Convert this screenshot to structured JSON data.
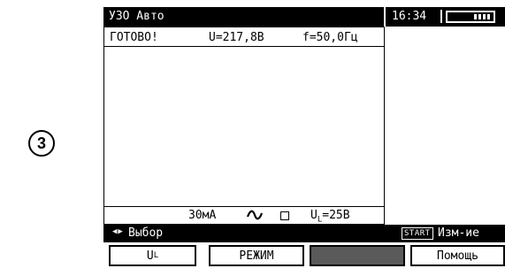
{
  "step_marker": "3",
  "header": {
    "title": "УЗО Авто",
    "time": "16:34",
    "battery_level": 1.0
  },
  "status": {
    "state": "ГОТОВО!",
    "voltage": "U=217,8В",
    "frequency": "f=50,0Гц"
  },
  "settings": {
    "current": "30мА",
    "wave_icon": "ac-sine-icon",
    "type_icon": "square-icon",
    "ul_prefix": "U",
    "ul_sub": "L",
    "ul_value": "=25В"
  },
  "navbar": {
    "arrows_icon": "left-right-arrows-icon",
    "select_label": "Выбор",
    "start_key": "START",
    "action_label": "Изм-ие"
  },
  "softkeys": {
    "f1_main": "U",
    "f1_sub": "L",
    "f2": "РЕЖИМ",
    "f3": "",
    "f4": "Помощь"
  }
}
